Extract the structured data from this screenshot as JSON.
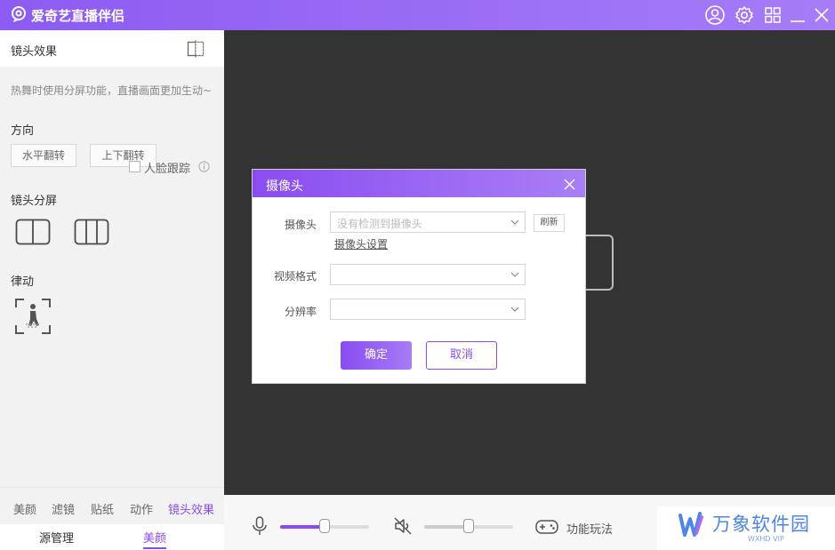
{
  "app": {
    "title": "爱奇艺直播伴侣"
  },
  "titlebar": {
    "icons": [
      "user-icon",
      "gear-icon",
      "grid-icon",
      "minimize-icon",
      "close-icon"
    ]
  },
  "left_panel": {
    "title": "镜头效果",
    "hint": "热舞时使用分屏功能，直播画面更加生动~",
    "direction_label": "方向",
    "flip_horizontal": "水平翻转",
    "flip_vertical": "上下翻转",
    "split_label": "镜头分屏",
    "face_tracking": "人脸跟踪",
    "rhythm_label": "律动",
    "tabs": [
      "美颜",
      "滤镜",
      "贴纸",
      "动作",
      "镜头效果"
    ],
    "active_tab": "镜头效果",
    "source_tabs": [
      "源管理",
      "美颜"
    ],
    "active_source_tab": "美颜"
  },
  "controls": {
    "mic_level": 0.5,
    "speaker_level": 0.5,
    "function_label": "功能玩法"
  },
  "watermark": {
    "text": "万象软件园",
    "sub": "WXHD VIP"
  },
  "modal": {
    "title": "摄像头",
    "camera_label": "摄像头",
    "camera_placeholder": "没有检测到摄像头",
    "refresh": "刷新",
    "camera_settings": "摄像头设置",
    "format_label": "视频格式",
    "format_value": "",
    "resolution_label": "分辨率",
    "resolution_value": "",
    "ok": "确定",
    "cancel": "取消"
  },
  "colors": {
    "accent": "#8a4cf0",
    "titlebar": "#9a6af5",
    "preview_bg": "#333333"
  }
}
